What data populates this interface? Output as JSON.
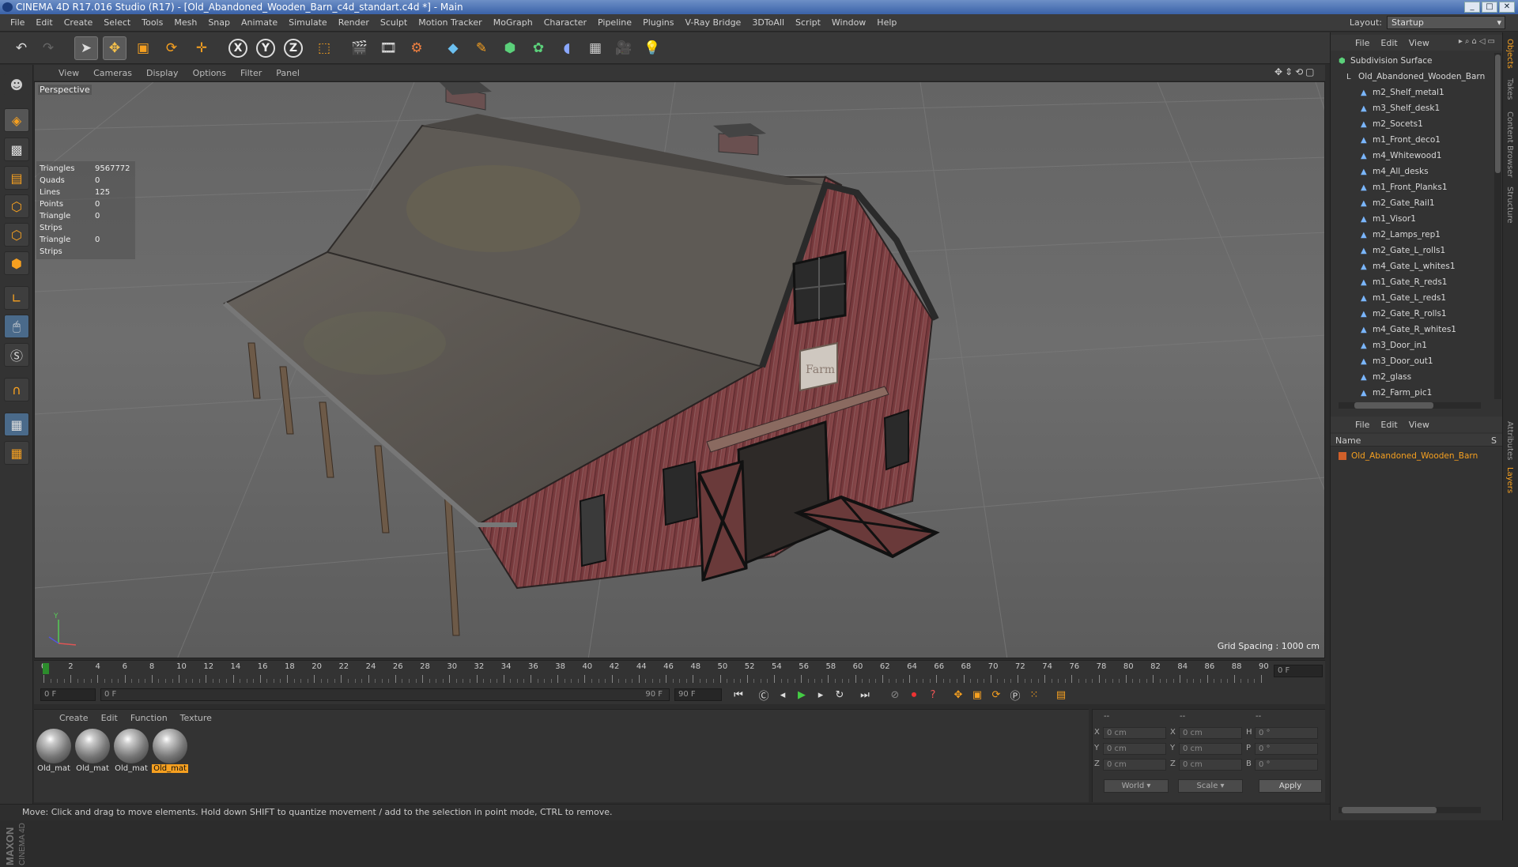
{
  "window": {
    "title": "CINEMA 4D R17.016 Studio (R17) - [Old_Abandoned_Wooden_Barn_c4d_standart.c4d *] - Main"
  },
  "menubar": [
    "File",
    "Edit",
    "Create",
    "Select",
    "Tools",
    "Mesh",
    "Snap",
    "Animate",
    "Simulate",
    "Render",
    "Sculpt",
    "Motion Tracker",
    "MoGraph",
    "Character",
    "Pipeline",
    "Plugins",
    "V-Ray Bridge",
    "3DToAll",
    "Script",
    "Window",
    "Help"
  ],
  "layout": {
    "label": "Layout:",
    "value": "Startup"
  },
  "toolbar": {
    "icons": [
      "undo-icon",
      "redo-icon",
      "select-arrow-icon",
      "move-icon",
      "scale-icon",
      "rotate-icon",
      "transform-icon",
      "x-axis-icon",
      "y-axis-icon",
      "z-axis-icon",
      "coordinate-system-icon",
      "render-view-icon",
      "render-picture-viewer-icon",
      "edit-render-settings-icon",
      "cube-icon",
      "pen-spline-icon",
      "subdivision-icon",
      "mograph-cloner-icon",
      "deformer-icon",
      "floor-icon",
      "camera-icon",
      "light-icon"
    ],
    "axis_labels": [
      "X",
      "Y",
      "Z"
    ]
  },
  "viewport": {
    "menu": [
      "View",
      "Cameras",
      "Display",
      "Options",
      "Filter",
      "Panel"
    ],
    "label": "Perspective",
    "stats": [
      {
        "k": "Triangles",
        "v": "9567772"
      },
      {
        "k": "Quads",
        "v": "0"
      },
      {
        "k": "Lines",
        "v": "125"
      },
      {
        "k": "Points",
        "v": "0"
      },
      {
        "k": "Triangle Strips",
        "v": "0"
      },
      {
        "k": "Triangle Strips",
        "v": "0"
      }
    ],
    "grid_spacing": "Grid Spacing : 1000 cm",
    "sign_text": "Farm"
  },
  "timeline": {
    "ticks": [
      "0",
      "2",
      "4",
      "6",
      "8",
      "10",
      "12",
      "14",
      "16",
      "18",
      "20",
      "22",
      "24",
      "26",
      "28",
      "30",
      "32",
      "34",
      "36",
      "38",
      "40",
      "42",
      "44",
      "46",
      "48",
      "50",
      "52",
      "54",
      "56",
      "58",
      "60",
      "62",
      "64",
      "66",
      "68",
      "70",
      "72",
      "74",
      "76",
      "78",
      "80",
      "82",
      "84",
      "86",
      "88",
      "90"
    ],
    "current_frame": "0 F",
    "start_field": "0 F",
    "range_start": "0 F",
    "range_end": "90 F",
    "end_field": "90 F"
  },
  "materials": {
    "menu": [
      "Create",
      "Edit",
      "Function",
      "Texture"
    ],
    "items": [
      "Old_mat",
      "Old_mat",
      "Old_mat",
      "Old_mat"
    ]
  },
  "coords": {
    "headers": [
      "--",
      "--",
      "--"
    ],
    "rows": [
      {
        "a": "X",
        "av": "0 cm",
        "b": "X",
        "bv": "0 cm",
        "c": "H",
        "cv": "0 °"
      },
      {
        "a": "Y",
        "av": "0 cm",
        "b": "Y",
        "bv": "0 cm",
        "c": "P",
        "cv": "0 °"
      },
      {
        "a": "Z",
        "av": "0 cm",
        "b": "Z",
        "bv": "0 cm",
        "c": "B",
        "cv": "0 °"
      }
    ],
    "world": "World",
    "scale": "Scale",
    "apply": "Apply"
  },
  "status": "Move: Click and drag to move elements. Hold down SHIFT to quantize movement / add to the selection in point mode, CTRL to remove.",
  "objects": {
    "menu": [
      "File",
      "Edit",
      "View"
    ],
    "root": "Subdivision Surface",
    "group": "Old_Abandoned_Wooden_Barn",
    "items": [
      "m2_Shelf_metal1",
      "m3_Shelf_desk1",
      "m2_Socets1",
      "m1_Front_deco1",
      "m4_Whitewood1",
      "m4_All_desks",
      "m1_Front_Planks1",
      "m2_Gate_Rail1",
      "m1_Visor1",
      "m2_Lamps_rep1",
      "m2_Gate_L_rolls1",
      "m4_Gate_L_whites1",
      "m1_Gate_R_reds1",
      "m1_Gate_L_reds1",
      "m2_Gate_R_rolls1",
      "m4_Gate_R_whites1",
      "m3_Door_in1",
      "m3_Door_out1",
      "m2_glass",
      "m2_Farm_pic1"
    ]
  },
  "layers": {
    "menu": [
      "File",
      "Edit",
      "View"
    ],
    "header": "Name",
    "header_right": "S",
    "items": [
      "Old_Abandoned_Wooden_Barn"
    ]
  },
  "side_tabs": [
    "Objects",
    "Takes",
    "Content Browser",
    "Structure",
    "Attributes",
    "Layers"
  ],
  "colors": {
    "accent": "#f6a020",
    "title_bar": "#3a62a8",
    "roof": "#5b5752",
    "wall": "#7b3a3e"
  }
}
